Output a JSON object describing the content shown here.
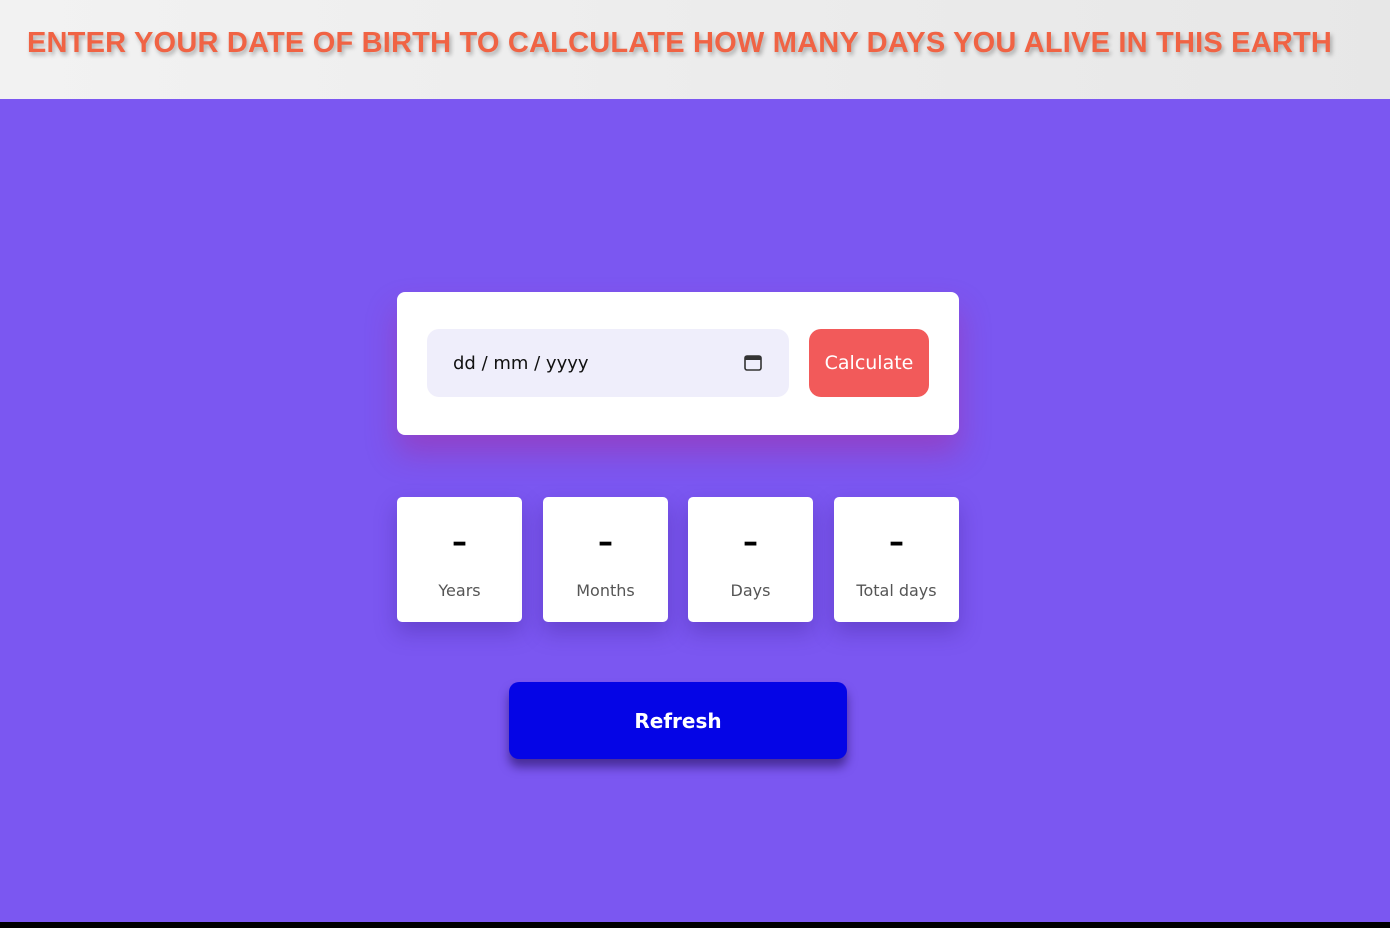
{
  "header": {
    "title": "ENTER YOUR DATE OF BIRTH TO CALCULATE HOW MANY DAYS YOU ALIVE IN THIS EARTH"
  },
  "form": {
    "date_placeholder": "dd / mm / yyyy",
    "calendar_icon": "calendar-icon",
    "calculate_label": "Calculate"
  },
  "results": [
    {
      "value": "–",
      "label": "Years"
    },
    {
      "value": "–",
      "label": "Months"
    },
    {
      "value": "–",
      "label": "Days"
    },
    {
      "value": "–",
      "label": "Total days"
    }
  ],
  "refresh_label": "Refresh",
  "colors": {
    "background": "#7b57f1",
    "title": "#f06344",
    "calculate_button": "#f25a5a",
    "refresh_button": "#0505e6",
    "date_field": "#efeefb"
  }
}
